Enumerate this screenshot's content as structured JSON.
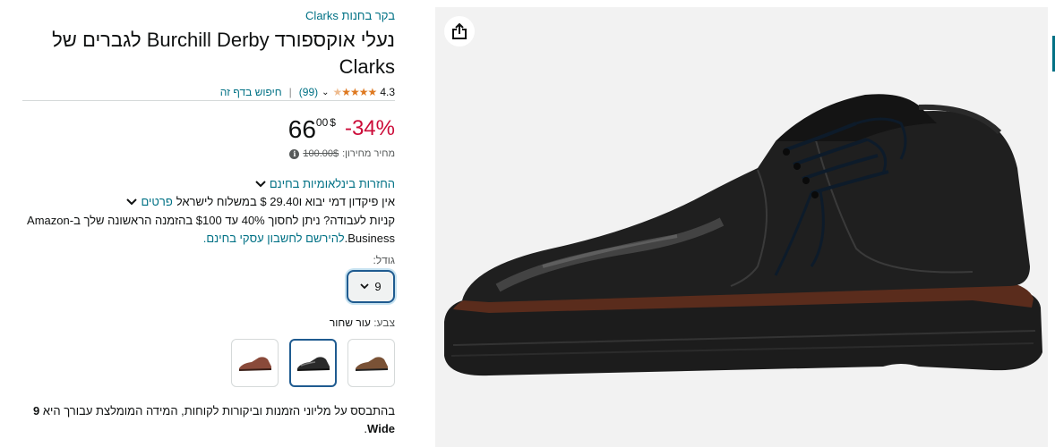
{
  "product": {
    "store_link": "בקר בחנות Clarks",
    "title": "נעלי אוקספורד Burchill Derby לגברים של Clarks",
    "rating": "4.3",
    "rating_count": "(99)",
    "search_page": "חיפוש בדף זה"
  },
  "pricing": {
    "discount": "-34%",
    "price_whole": "66",
    "price_fraction": "00",
    "currency": "$",
    "list_price_label": "מחיר מחירון:",
    "list_price": "100.00$"
  },
  "delivery": {
    "returns": "החזרות בינלאומיות בחינם",
    "shipping_text": "אין פיקדון דמי יבוא ו29.40 $ במשלוח לישראל",
    "details_link": "פרטים"
  },
  "business": {
    "text": "קניות לעבודה? ניתן לחסוך 40% עד $100 בהזמנה הראשונה שלך ב-Amazon Business.",
    "link": "להירשם לחשבון עסקי בחינם."
  },
  "size": {
    "label": "גודל:",
    "value": "9"
  },
  "color": {
    "label": "צבע:",
    "value": "עור שחור",
    "swatches": [
      "brown-leather",
      "black-leather",
      "tan-leather"
    ]
  },
  "recommendation": {
    "text": "בהתבסס על מליוני הזמנות וביקורות לקוחות, המידה המומלצת עבורך היא",
    "size": "9 Wide",
    "end": "."
  },
  "icons": {
    "share": "share-icon",
    "stars": "star-rating-icon",
    "info": "info-icon"
  },
  "colors": {
    "link": "#007185",
    "discount": "#cc0c39",
    "stars": "#de7921",
    "selected_border": "#1f5b90"
  }
}
